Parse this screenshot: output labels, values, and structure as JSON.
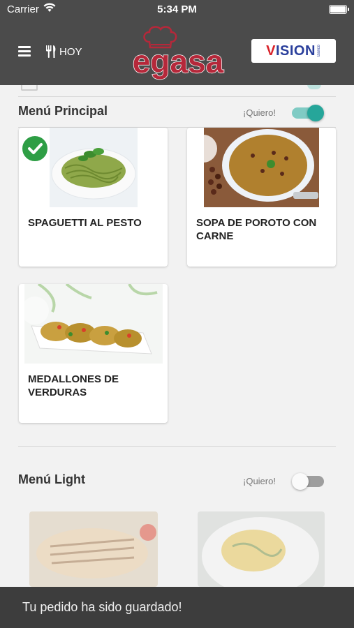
{
  "status_bar": {
    "carrier": "Carrier",
    "time": "5:34 PM"
  },
  "header": {
    "hoy_label": "HOY",
    "logo_text": "egasa",
    "partner_logo_text": "VISION",
    "partner_logo_subtext": "Banco"
  },
  "menu_principal": {
    "title": "Menú Principal",
    "quiero_label": "¡Quiero!",
    "toggle_on": true,
    "items": [
      {
        "name": "SPAGUETTI AL PESTO",
        "selected": true
      },
      {
        "name": "SOPA DE POROTO CON CARNE",
        "selected": false
      },
      {
        "name": "MEDALLONES DE VERDURAS",
        "selected": false
      }
    ]
  },
  "menu_light": {
    "title": "Menú Light",
    "quiero_label": "¡Quiero!",
    "toggle_on": false
  },
  "snackbar": {
    "message": "Tu pedido ha sido guardado!"
  },
  "colors": {
    "header_bg": "#4b4b4b",
    "accent_teal": "#26a69a",
    "check_green": "#2e9e45",
    "logo_red": "#b5283a",
    "snackbar_bg": "#3d3d3d"
  }
}
